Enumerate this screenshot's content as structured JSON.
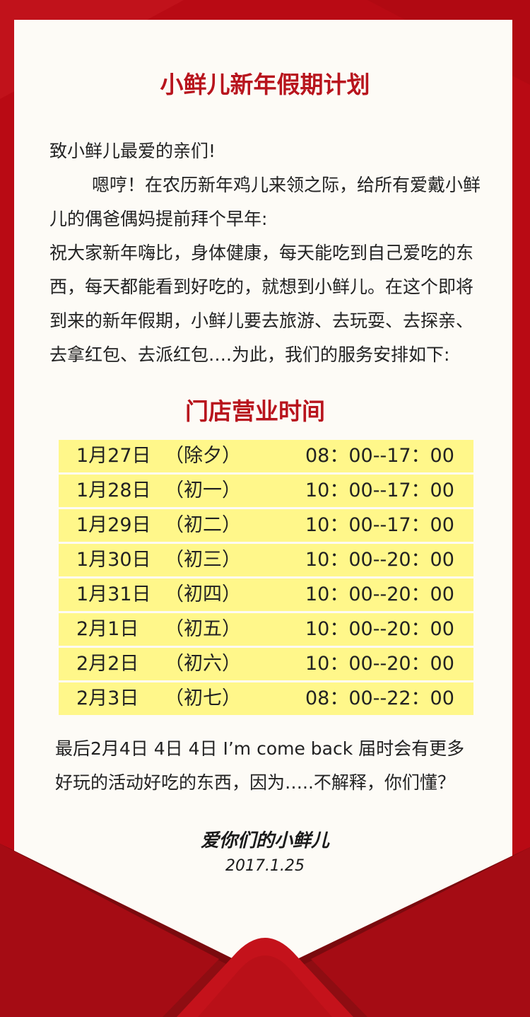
{
  "colors": {
    "accent": "#b8141d",
    "background": "#b90a14",
    "card": "#fdfbf6",
    "highlight": "#fff78a"
  },
  "title": "小鲜儿新年假期计划",
  "greeting": "致小鲜儿最爱的亲们!",
  "paragraphs": [
    "嗯哼！在农历新年鸡儿来领之际，给所有爱戴小鲜",
    "儿的偶爸偶妈提前拜个早年:",
    "祝大家新年嗨比，身体健康，每天能吃到自己爱吃的东",
    "西，每天都能看到好吃的，就想到小鲜儿。在这个即将",
    "到来的新年假期，小鲜儿要去旅游、去玩耍、去探亲、",
    "去拿红包、去派红包….为此，我们的服务安排如下:"
  ],
  "schedule": {
    "title": "门店营业时间",
    "rows": [
      {
        "date": "1月27日",
        "lunar": "（除夕）",
        "hours": "08：00--17：00"
      },
      {
        "date": "1月28日",
        "lunar": "（初一）",
        "hours": "10：00--17：00"
      },
      {
        "date": "1月29日",
        "lunar": "（初二）",
        "hours": "10：00--17：00"
      },
      {
        "date": "1月30日",
        "lunar": "（初三）",
        "hours": "10：00--20：00"
      },
      {
        "date": "1月31日",
        "lunar": "（初四）",
        "hours": "10：00--20：00"
      },
      {
        "date": "2月1日",
        "lunar": "（初五）",
        "hours": "10：00--20：00"
      },
      {
        "date": "2月2日",
        "lunar": "（初六）",
        "hours": "10：00--20：00"
      },
      {
        "date": "2月3日",
        "lunar": "（初七）",
        "hours": "08：00--22：00"
      }
    ]
  },
  "closing": [
    "最后2月4日 4日 4日 I’m come back    届时会有更多",
    "好玩的活动好吃的东西，因为…..不解释，你们懂？"
  ],
  "signature": "爱你们的小鲜儿",
  "signature_date": "2017.1.25"
}
